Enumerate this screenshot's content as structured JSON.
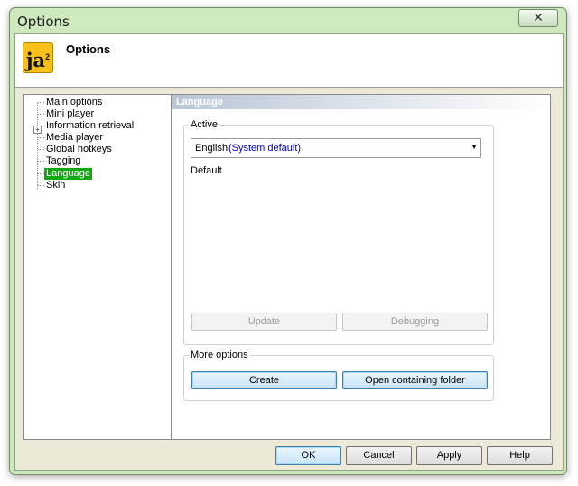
{
  "window": {
    "title": "Options",
    "close_symbol": "✕"
  },
  "header": {
    "logo_text": "ja",
    "logo_sup": "2",
    "title": "Options"
  },
  "tree": {
    "items": [
      {
        "label": "Main options",
        "selected": false,
        "expander": false
      },
      {
        "label": "Mini player",
        "selected": false,
        "expander": false
      },
      {
        "label": "Information retrieval",
        "selected": false,
        "expander": true
      },
      {
        "label": "Media player",
        "selected": false,
        "expander": false
      },
      {
        "label": "Global hotkeys",
        "selected": false,
        "expander": false
      },
      {
        "label": "Tagging",
        "selected": false,
        "expander": false
      },
      {
        "label": "Language",
        "selected": true,
        "expander": false
      },
      {
        "label": "Skin",
        "selected": false,
        "expander": false
      }
    ],
    "expander_symbol": "+"
  },
  "section": {
    "title": "Language"
  },
  "active_group": {
    "label": "Active",
    "selected_language": "English",
    "selected_note": "(System default)",
    "dropdown_arrow": "▼",
    "info_text": "Default",
    "update_button": "Update",
    "debugging_button": "Debugging"
  },
  "more_group": {
    "label": "More options",
    "create_button": "Create",
    "open_folder_button": "Open containing folder"
  },
  "footer": {
    "ok": "OK",
    "cancel": "Cancel",
    "apply": "Apply",
    "help": "Help"
  },
  "colors": {
    "selection": "#0fa80f",
    "window_frame": "#cfe9bf",
    "note_text": "#0000c8"
  }
}
